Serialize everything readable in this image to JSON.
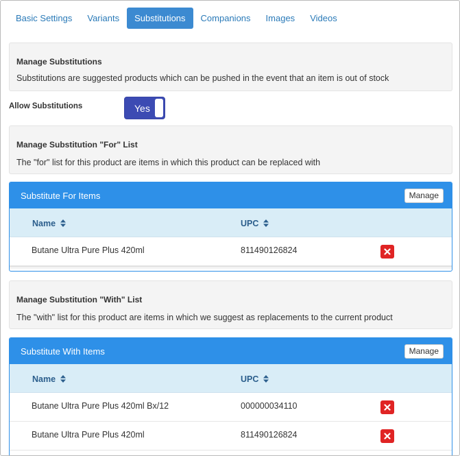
{
  "tabs": [
    {
      "label": "Basic Settings",
      "active": false
    },
    {
      "label": "Variants",
      "active": false
    },
    {
      "label": "Substitutions",
      "active": true
    },
    {
      "label": "Companions",
      "active": false
    },
    {
      "label": "Images",
      "active": false
    },
    {
      "label": "Videos",
      "active": false
    }
  ],
  "manage_section": {
    "title": "Manage Substitutions",
    "description": "Substitutions are suggested products which can be pushed in the event that an item is out of stock"
  },
  "allow": {
    "label": "Allow Substitutions",
    "toggle_text": "Yes",
    "enabled": true
  },
  "for_section": {
    "title": "Manage Substitution \"For\" List",
    "description": "The \"for\" list for this product are items in which this product can be replaced with"
  },
  "for_panel": {
    "title": "Substitute For Items",
    "manage_label": "Manage",
    "columns": {
      "name": "Name",
      "upc": "UPC"
    },
    "rows": [
      {
        "name": "Butane Ultra Pure Plus 420ml",
        "upc": "811490126824"
      }
    ]
  },
  "with_section": {
    "title": "Manage Substitution \"With\" List",
    "description": "The \"with\" list for this product are items in which we suggest as replacements to the current product"
  },
  "with_panel": {
    "title": "Substitute With Items",
    "manage_label": "Manage",
    "columns": {
      "name": "Name",
      "upc": "UPC"
    },
    "rows": [
      {
        "name": "Butane Ultra Pure Plus 420ml Bx/12",
        "upc": "000000034110"
      },
      {
        "name": "Butane Ultra Pure Plus 420ml",
        "upc": "811490126824"
      }
    ]
  },
  "colors": {
    "accent": "#2e90e8",
    "active_tab": "#3c8ad1",
    "toggle": "#3c4bb3",
    "delete": "#e02424",
    "table_header": "#d9edf7"
  }
}
